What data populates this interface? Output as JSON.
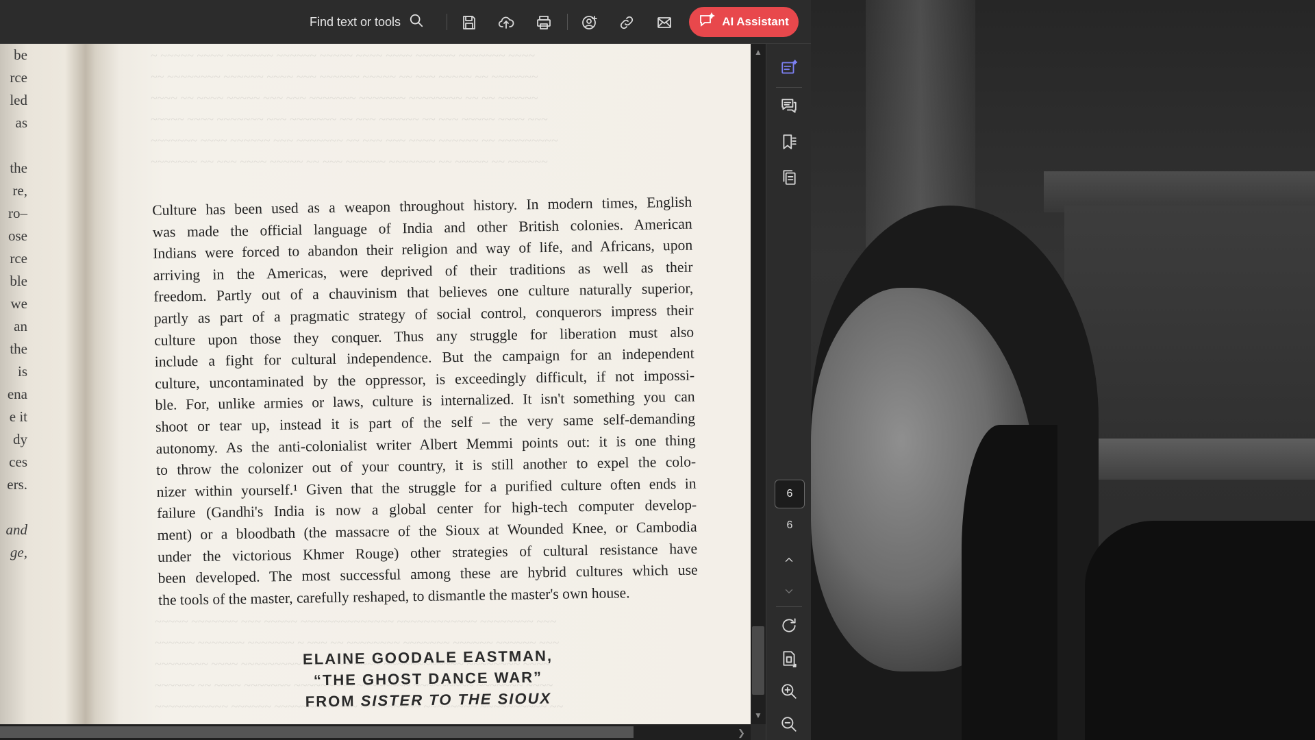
{
  "toolbar": {
    "find_label": "Find text or tools",
    "ai_button_label": "AI Assistant",
    "icons": [
      "search-icon",
      "save-icon",
      "upload-icon",
      "print-icon",
      "share-user-icon",
      "link-icon",
      "mail-icon"
    ]
  },
  "page": {
    "margin_fragments": [
      "be",
      "rce",
      "led",
      "as",
      "",
      "the",
      "re,",
      "ro–",
      "ose",
      "rce",
      "ble",
      "we",
      "an",
      "the",
      "is",
      "ena",
      "e it",
      "dy",
      "ces",
      "ers.",
      "",
      "and",
      "ge,"
    ],
    "body_lines": [
      "Culture has been used as a weapon throughout history. In modern times, English",
      "was made the official language of India and other British colonies. American",
      "Indians were forced to abandon their religion and way of life, and Africans, upon",
      "arriving in the Americas, were deprived of their traditions as well as their",
      "freedom. Partly out of a chauvinism that believes one culture naturally superior,",
      "partly as part of a pragmatic strategy of social control, conquerors impress their",
      "culture upon those they conquer. Thus any struggle for liberation must also",
      "include a fight for cultural independence. But the campaign for an independent",
      "culture, uncontaminated by the oppressor, is exceedingly difficult, if not impossi-",
      "ble. For, unlike armies or laws, culture is internalized. It isn't something you can",
      "shoot or tear up, instead it is part of the self – the very same self-demanding",
      "autonomy. As the anti-colonialist writer Albert Memmi points out: it is one thing",
      "to throw the colonizer out of your country, it is still another to expel the colo-",
      "nizer within yourself.¹ Given that the struggle for a purified culture often ends in",
      "failure (Gandhi's India is now a global center for high-tech computer develop-",
      "ment) or a bloodbath (the massacre of the Sioux at Wounded Knee, or Cambodia",
      "under the victorious Khmer Rouge) other strategies of cultural resistance have",
      "been developed. The most successful among these are hybrid cultures which use",
      "the tools of the master, carefully reshaped, to dismantle the master's own house."
    ],
    "heading": {
      "line1": "ELAINE GOODALE EASTMAN,",
      "line2": "“THE GHOST DANCE WAR”",
      "line3_prefix": "FROM ",
      "line3_title": "SISTER TO THE SIOUX"
    }
  },
  "sidebar": {
    "icons": [
      "ai-chat-icon",
      "comment-icon",
      "bookmark-icon",
      "pages-icon",
      "rotate-icon",
      "page-layout-icon",
      "zoom-in-icon",
      "zoom-out-icon"
    ],
    "current_page": "6",
    "total_pages": "6"
  }
}
